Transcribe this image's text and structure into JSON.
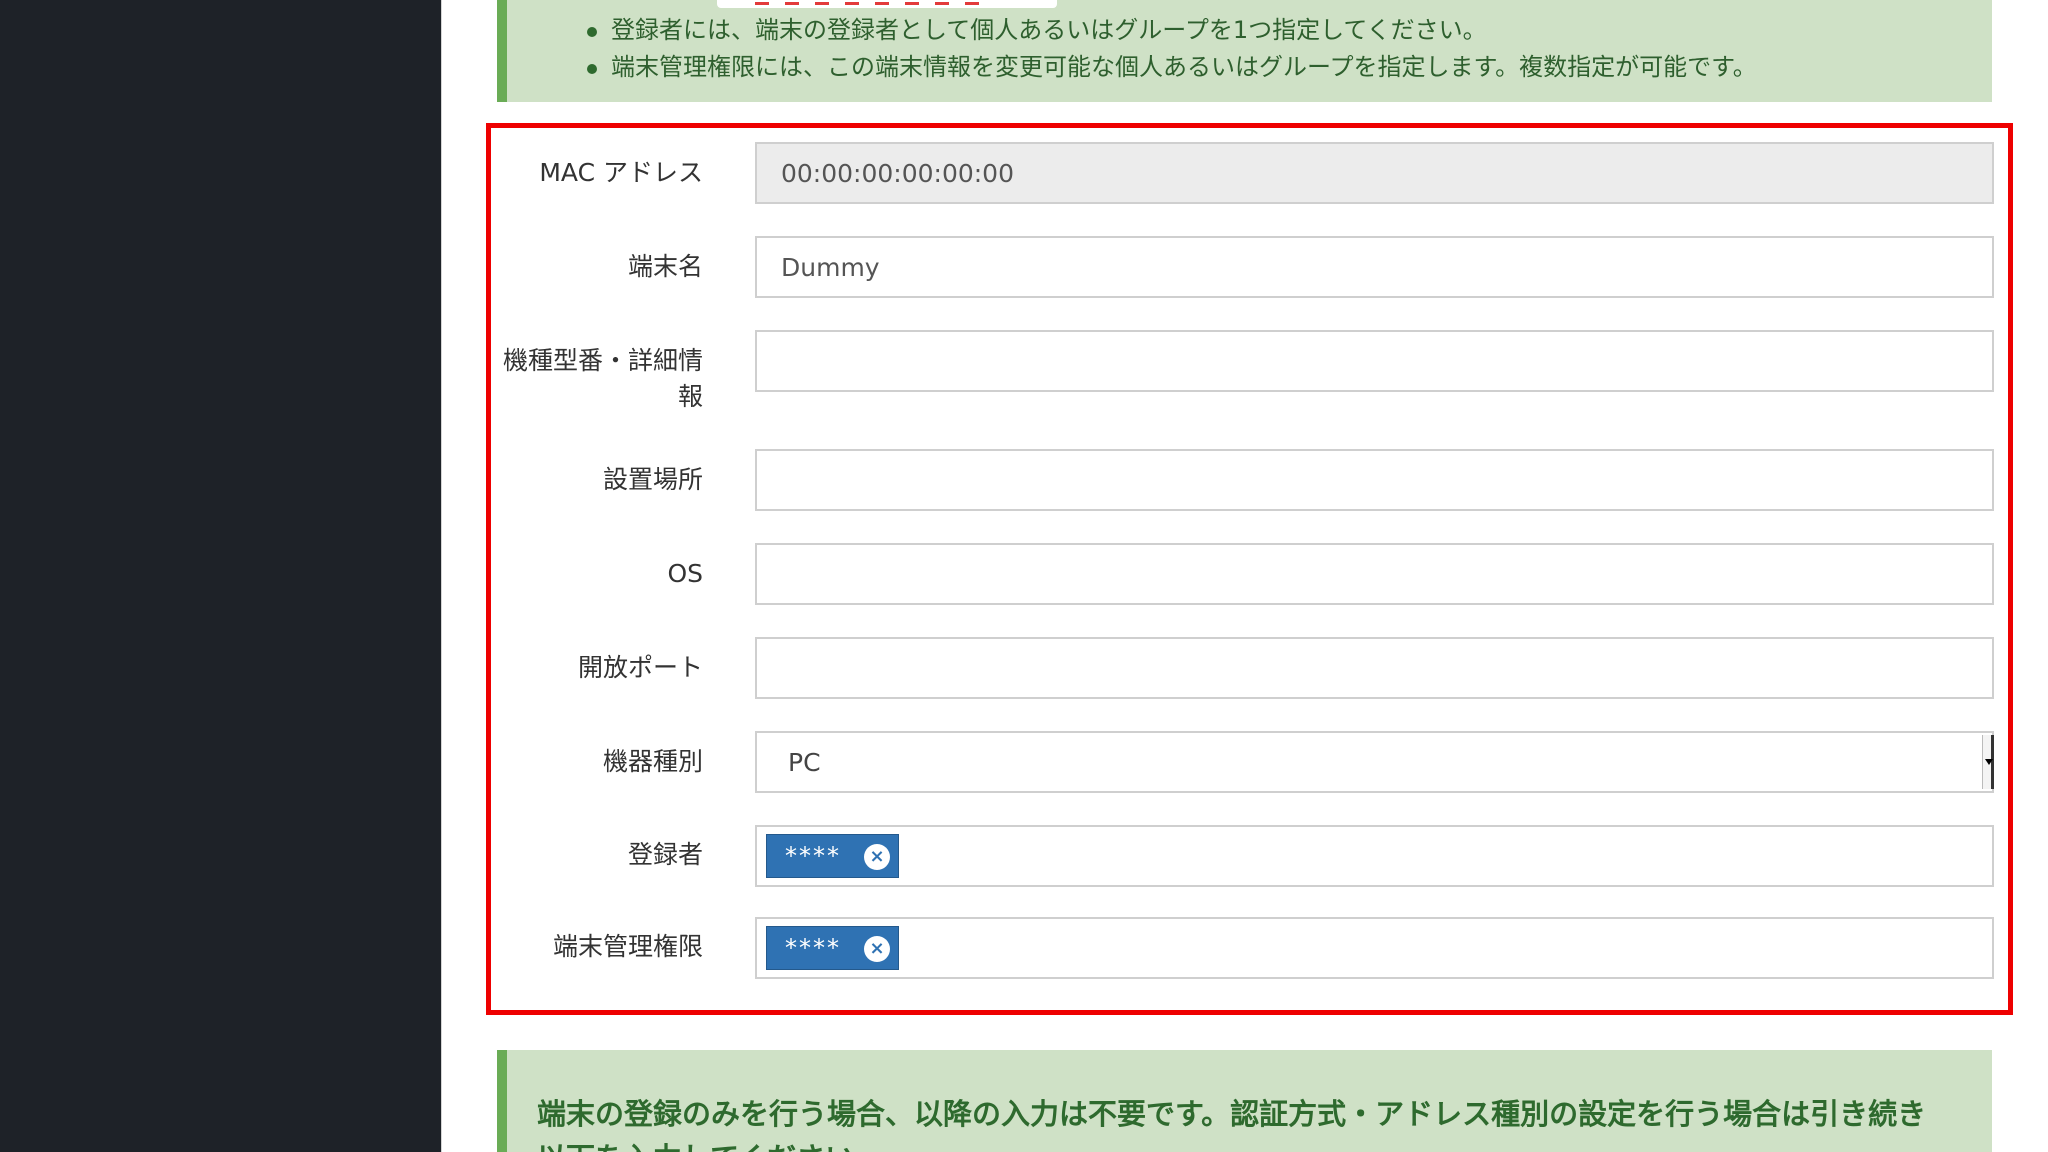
{
  "notes_top": {
    "items": [
      "登録者には、端末の登録者として個人あるいはグループを1つ指定してください。",
      "端末管理権限には、この端末情報を変更可能な個人あるいはグループを指定します。複数指定が可能です。"
    ]
  },
  "form": {
    "mac": {
      "label": "MAC アドレス",
      "value": "00:00:00:00:00:00"
    },
    "device_name": {
      "label": "端末名",
      "value": "Dummy"
    },
    "model": {
      "label_line1": "機種型番・詳細情",
      "label_line2": "報",
      "value": ""
    },
    "location": {
      "label": "設置場所",
      "value": ""
    },
    "os": {
      "label": "OS",
      "value": ""
    },
    "ports": {
      "label": "開放ポート",
      "value": ""
    },
    "device_type": {
      "label": "機器種別",
      "selected": "PC"
    },
    "registrant": {
      "label": "登録者",
      "tag": "****"
    },
    "admin": {
      "label": "端末管理権限",
      "tag": "****"
    }
  },
  "notes_bottom": {
    "text_line1": "端末の登録のみを行う場合、以降の入力は不要です。認証方式・アドレス種別の設定を行う場合は引き続き",
    "text_line2": "以下を入力してください。"
  },
  "colors": {
    "sidebar": "#1e2228",
    "note_bg": "#cfe1c6",
    "note_border": "#6aac56",
    "highlight_border": "#ee0000",
    "tag_bg": "#2f72b3"
  }
}
